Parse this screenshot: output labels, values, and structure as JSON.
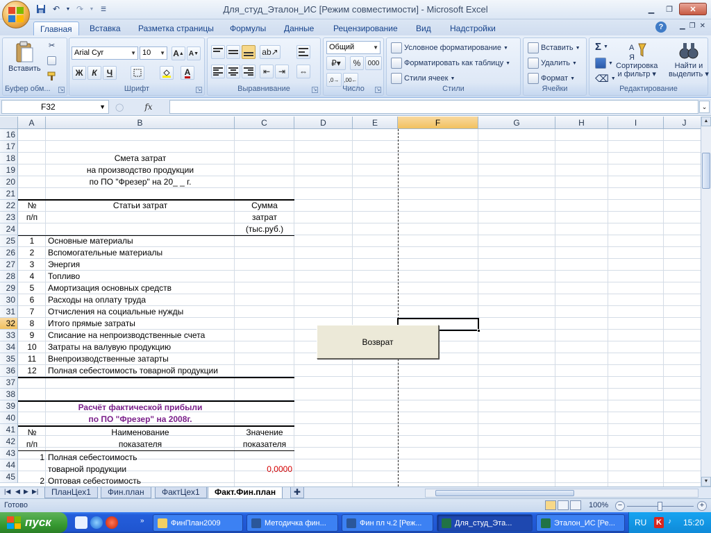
{
  "window": {
    "title": "Для_студ_Эталон_ИС  [Режим совместимости] - Microsoft Excel"
  },
  "ribbon_tabs": [
    "Главная",
    "Вставка",
    "Разметка страницы",
    "Формулы",
    "Данные",
    "Рецензирование",
    "Вид",
    "Надстройки"
  ],
  "ribbon": {
    "clipboard": {
      "paste": "Вставить",
      "label": "Буфер обм..."
    },
    "font": {
      "name": "Arial Cyr",
      "size": "10",
      "bold": "Ж",
      "italic": "К",
      "underline": "Ч",
      "label": "Шрифт"
    },
    "alignment": {
      "label": "Выравнивание"
    },
    "number": {
      "format": "Общий",
      "percent": "%",
      "thousands": "000",
      "label": "Число"
    },
    "styles": {
      "conditional": "Условное форматирование",
      "as_table": "Форматировать как таблицу",
      "cell_styles": "Стили ячеек",
      "label": "Стили"
    },
    "cells": {
      "insert": "Вставить",
      "delete": "Удалить",
      "format": "Формат",
      "label": "Ячейки"
    },
    "editing": {
      "sum": "Σ",
      "sort_line1": "Сортировка",
      "sort_line2": "и фильтр",
      "find_line1": "Найти и",
      "find_line2": "выделить",
      "label": "Редактирование"
    }
  },
  "formula_bar": {
    "name_box": "F32",
    "fx": "fx",
    "value": ""
  },
  "columns": [
    "A",
    "B",
    "C",
    "D",
    "E",
    "F",
    "G",
    "H",
    "I",
    "J"
  ],
  "selected_column": "F",
  "rows": [
    "16",
    "17",
    "18",
    "19",
    "20",
    "21",
    "22",
    "23",
    "24",
    "25",
    "26",
    "27",
    "28",
    "29",
    "30",
    "31",
    "32",
    "33",
    "34",
    "35",
    "36",
    "37",
    "38",
    "39",
    "40",
    "41",
    "42",
    "43",
    "44",
    "45"
  ],
  "selected_row": "32",
  "sheet": {
    "estimate_title": [
      "Смета  затрат",
      "на производство продукции",
      "по ПО \"Фрезер\" на 20_ _ г."
    ],
    "estimate_header": {
      "num1": "№",
      "num2": "п/п",
      "items": "Статьи затрат",
      "sum1": "Сумма",
      "sum2": "затрат",
      "sum3": "(тыс.руб.)"
    },
    "estimate_items": [
      {
        "n": "1",
        "name": "Основные материалы"
      },
      {
        "n": "2",
        "name": "Вспомогательные материалы"
      },
      {
        "n": "3",
        "name": "Энергия"
      },
      {
        "n": "4",
        "name": "Топливо"
      },
      {
        "n": "5",
        "name": "Амортизация основных средств"
      },
      {
        "n": "6",
        "name": "Расходы на оплату труда"
      },
      {
        "n": "7",
        "name": "Отчисления на социальные нужды"
      },
      {
        "n": "8",
        "name": "Итого прямые затраты"
      },
      {
        "n": "9",
        "name": "Списание на непроизводственные счета"
      },
      {
        "n": "10",
        "name": "Затраты на валувую продукцию"
      },
      {
        "n": "11",
        "name": "Внепроизводственные затарты"
      },
      {
        "n": "12",
        "name": "Полная себестоимость товарной продукции"
      }
    ],
    "profit_title": [
      "Расчёт фактической прибыли",
      "по ПО \"Фрезер\" на 2008г."
    ],
    "profit_header": {
      "num1": "№",
      "num2": "п/п",
      "name1": "Наименование",
      "name2": "показателя",
      "val1": "Значение",
      "val2": "показателя"
    },
    "profit_items": [
      {
        "n": "1",
        "name1": "Полная себестоимость",
        "name2": "товарной продукции",
        "value": "0,0000"
      },
      {
        "n": "2",
        "name1": "Оптовая себестоимость"
      }
    ],
    "return_button": "Возврат"
  },
  "sheet_tabs": [
    "ПланЦех1",
    "Фин.план",
    "ФактЦех1",
    "Факт.Фин.план"
  ],
  "active_sheet": "Факт.Фин.план",
  "status": {
    "text": "Готово",
    "zoom": "100%"
  },
  "taskbar": {
    "start": "пуск",
    "tasks": [
      "ФинПлан2009",
      "Методичка фин...",
      "Фин пл ч.2 [Реж...",
      "Для_студ_Эта...",
      "Эталон_ИС [Ре..."
    ],
    "active_task": "Для_студ_Эта...",
    "lang": "RU",
    "clock": "15:20"
  },
  "colors": {
    "accent": "#15428b",
    "selected_header": "#f1c15f",
    "title_purple": "#7a1f8a",
    "value_red": "#d40000"
  }
}
